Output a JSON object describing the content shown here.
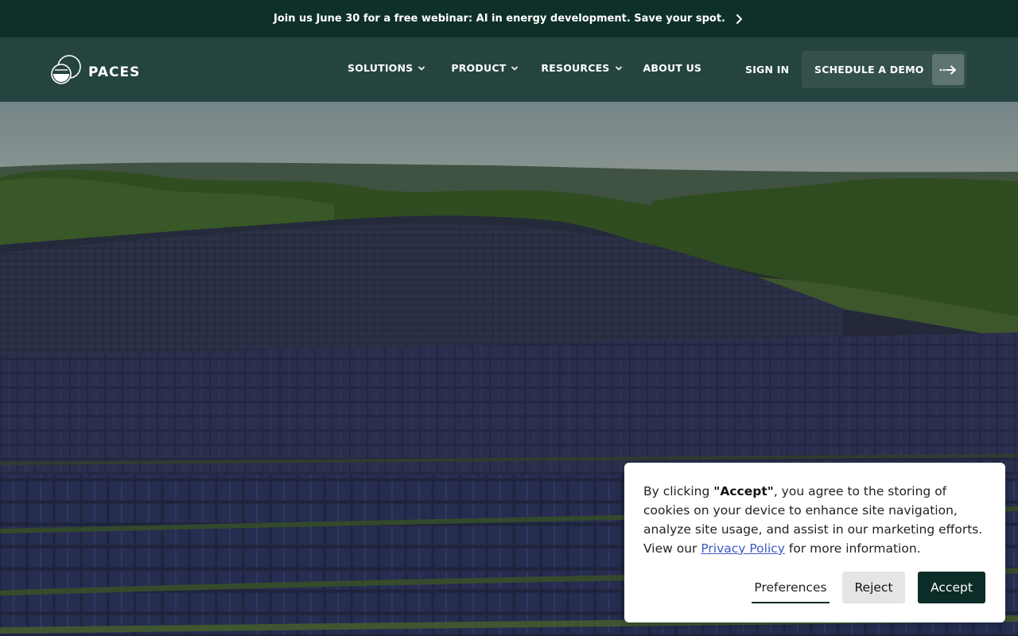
{
  "announcement": {
    "text": "Join us June 30 for a free webinar: AI in energy development. Save your spot.",
    "icon": "chevron-right-icon"
  },
  "header": {
    "logo_text": "PACES",
    "nav": [
      {
        "label": "SOLUTIONS",
        "has_dropdown": true
      },
      {
        "label": "PRODUCT",
        "has_dropdown": true
      },
      {
        "label": "RESOURCES",
        "has_dropdown": true
      },
      {
        "label": "ABOUT US",
        "has_dropdown": false
      }
    ],
    "sign_in": "SIGN IN",
    "demo_button": "SCHEDULE A DEMO",
    "demo_icon": "arrow-right-icon"
  },
  "hero": {
    "image_subject": "aerial-solar-farm"
  },
  "cookie": {
    "text_before": "By clicking ",
    "text_bold": "\"Accept\"",
    "text_middle": ", you agree to the storing of cookies on your device to enhance site navigation, analyze site usage, and assist in our marketing efforts. View our ",
    "link": "Privacy Policy",
    "text_after": " for more information.",
    "preferences": "Preferences",
    "reject": "Reject",
    "accept": "Accept"
  },
  "colors": {
    "announce_bg": "#0f3029",
    "header_bg": "#254440",
    "accent": "#0c2d27",
    "link": "#3d59c8"
  }
}
